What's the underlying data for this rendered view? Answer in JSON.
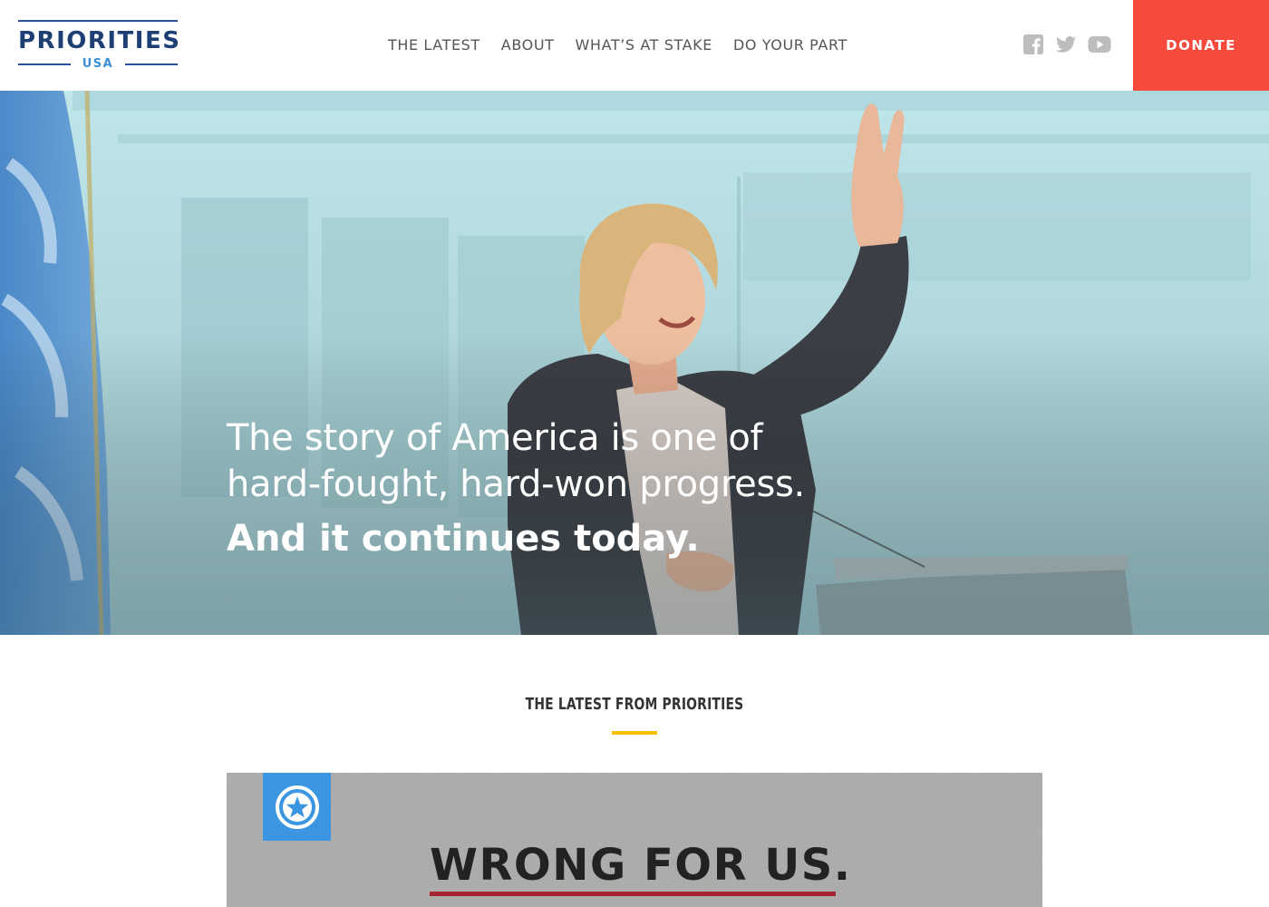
{
  "header": {
    "logo": {
      "word": "PRIORITIES",
      "sub": "USA"
    },
    "nav": [
      {
        "label": "THE LATEST"
      },
      {
        "label": "ABOUT"
      },
      {
        "label": "WHAT’S AT STAKE"
      },
      {
        "label": "DO YOUR PART"
      }
    ],
    "social": [
      {
        "icon": "facebook-icon"
      },
      {
        "icon": "twitter-icon"
      },
      {
        "icon": "youtube-icon"
      }
    ],
    "donate_label": "DONATE",
    "colors": {
      "donate": "#f64b3c",
      "logo_navy": "#1d3f73",
      "logo_blue": "#3a8fd9",
      "icon_gray": "#bdbdbd"
    }
  },
  "hero": {
    "line1": "The story of America is one of",
    "line2": "hard-fought, hard-won progress.",
    "emphasis": "And it continues today."
  },
  "latest": {
    "title": "THE LATEST FROM PRIORITIES",
    "accent_color": "#f5c200",
    "card": {
      "badge_icon": "star-circle-icon",
      "headline": "WRONG FOR US.",
      "badge_color": "#3b95e0",
      "underline_color": "#a52632"
    }
  }
}
